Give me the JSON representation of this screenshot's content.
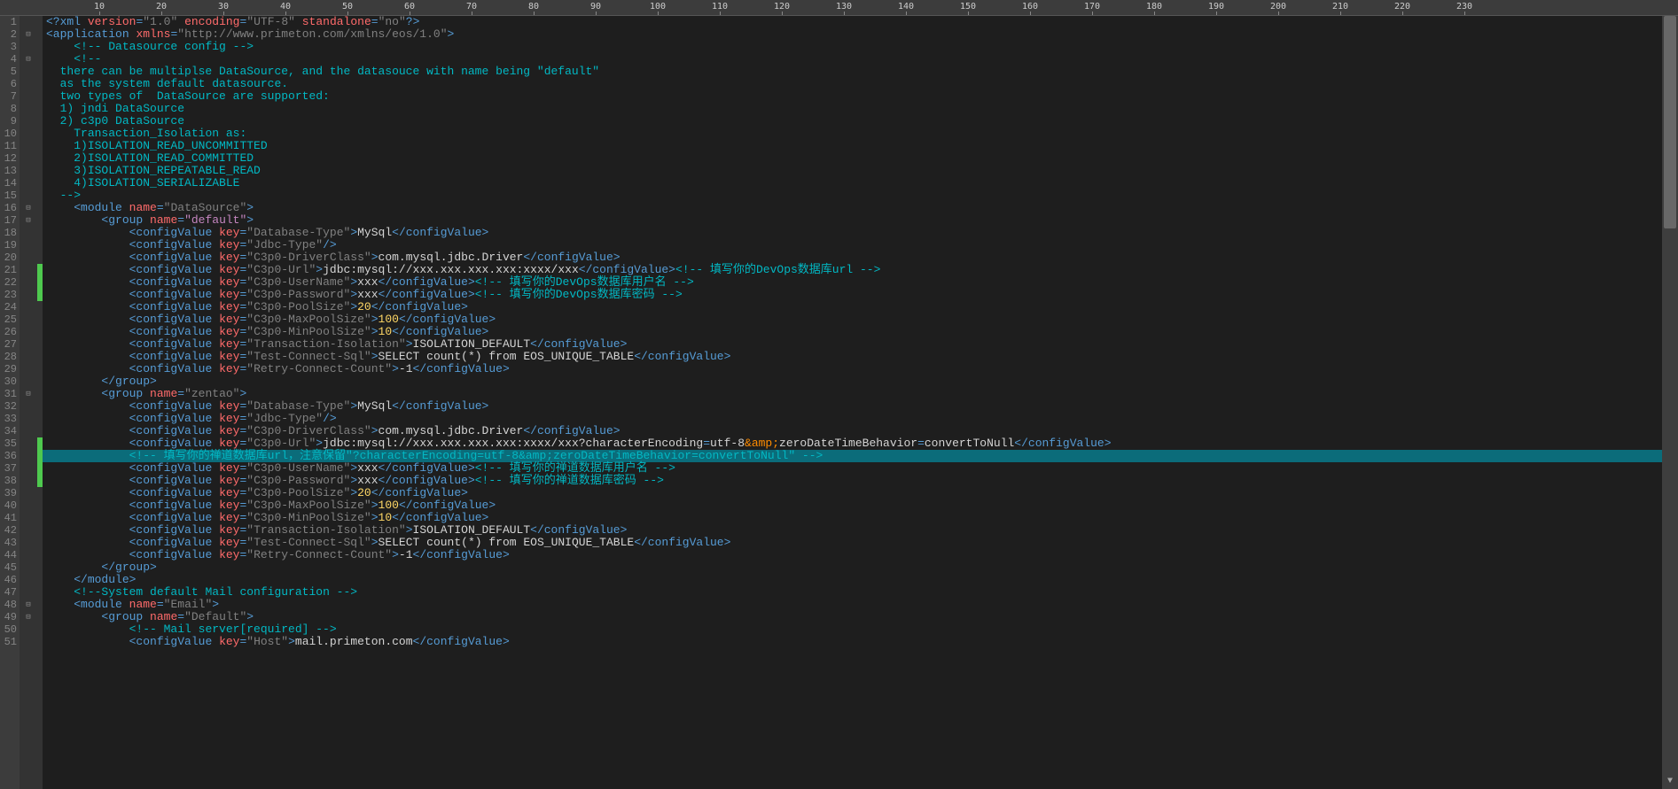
{
  "ruler": {
    "major_every": 10,
    "char_width": 7.0,
    "max": 230
  },
  "gutter": {
    "start": 1,
    "end": 51
  },
  "fold_markers": {
    "2": "-",
    "4": "-",
    "16": "-",
    "17": "-",
    "31": "-",
    "48": "-",
    "49": "-"
  },
  "change_markers": [
    21,
    22,
    23,
    35,
    36,
    37,
    38
  ],
  "highlighted_line": 36,
  "lines": [
    {
      "n": 1,
      "html": "<span class='tag'>&lt;?</span><span class='pi'>xml</span> <span class='att-n'>version</span><span class='tag'>=</span><span class='str'>\"1.0\"</span> <span class='att-n'>encoding</span><span class='tag'>=</span><span class='str'>\"UTF-8\"</span> <span class='att-n'>standalone</span><span class='tag'>=</span><span class='str'>\"no\"</span><span class='tag'>?&gt;</span>"
    },
    {
      "n": 2,
      "html": "<span class='tag'>&lt;application</span> <span class='att-n'>xmlns</span><span class='tag'>=</span><span class='str'>\"http://www.primeton.com/xmlns/eos/1.0\"</span><span class='tag'>&gt;</span>"
    },
    {
      "n": 3,
      "html": "    <span class='cmt'>&lt;!-- Datasource config --&gt;</span>"
    },
    {
      "n": 4,
      "html": "    <span class='cmt'>&lt;!--</span>"
    },
    {
      "n": 5,
      "html": "  <span class='cmt'>there can be multiplse DataSource, and the datasouce with name being \"default\"</span>"
    },
    {
      "n": 6,
      "html": "  <span class='cmt'>as the system default datasource.</span>"
    },
    {
      "n": 7,
      "html": "  <span class='cmt'>two types of  DataSource are supported:</span>"
    },
    {
      "n": 8,
      "html": "  <span class='cmt'>1) jndi DataSource</span>"
    },
    {
      "n": 9,
      "html": "  <span class='cmt'>2) c3p0 DataSource</span>"
    },
    {
      "n": 10,
      "html": "    <span class='cmt'>Transaction_Isolation as:</span>"
    },
    {
      "n": 11,
      "html": "    <span class='cmt'>1)ISOLATION_READ_UNCOMMITTED</span>"
    },
    {
      "n": 12,
      "html": "    <span class='cmt'>2)ISOLATION_READ_COMMITTED</span>"
    },
    {
      "n": 13,
      "html": "    <span class='cmt'>3)ISOLATION_REPEATABLE_READ</span>"
    },
    {
      "n": 14,
      "html": "    <span class='cmt'>4)ISOLATION_SERIALIZABLE</span>"
    },
    {
      "n": 15,
      "html": "  <span class='cmt'>--&gt;</span>"
    },
    {
      "n": 16,
      "html": "    <span class='tag'>&lt;module</span> <span class='att-n'>name</span><span class='tag'>=</span><span class='str'>\"DataSource\"</span><span class='tag'>&gt;</span>"
    },
    {
      "n": 17,
      "html": "        <span class='tag'>&lt;group</span> <span class='att-n'>name</span><span class='tag'>=</span><span class='kw'>\"default\"</span><span class='tag'>&gt;</span>"
    },
    {
      "n": 18,
      "html": "            <span class='tag'>&lt;configValue</span> <span class='att-n'>key</span><span class='tag'>=</span><span class='str'>\"Database-Type\"</span><span class='tag'>&gt;</span><span class='txt'>MySql</span><span class='tag'>&lt;/configValue&gt;</span>"
    },
    {
      "n": 19,
      "html": "            <span class='tag'>&lt;configValue</span> <span class='att-n'>key</span><span class='tag'>=</span><span class='str'>\"Jdbc-Type\"</span><span class='tag'>/&gt;</span>"
    },
    {
      "n": 20,
      "html": "            <span class='tag'>&lt;configValue</span> <span class='att-n'>key</span><span class='tag'>=</span><span class='str'>\"C3p0-DriverClass\"</span><span class='tag'>&gt;</span><span class='txt'>com.mysql.jdbc.Driver</span><span class='tag'>&lt;/configValue&gt;</span>"
    },
    {
      "n": 21,
      "html": "            <span class='tag'>&lt;configValue</span> <span class='att-n'>key</span><span class='tag'>=</span><span class='str'>\"C3p0-Url\"</span><span class='tag'>&gt;</span><span class='txt'>jdbc:mysql://xxx.xxx.xxx.xxx:xxxx/xxx</span><span class='tag'>&lt;/configValue&gt;</span><span class='cmt'>&lt;!-- 填写你的DevOps数据库url --&gt;</span>"
    },
    {
      "n": 22,
      "html": "            <span class='tag'>&lt;configValue</span> <span class='att-n'>key</span><span class='tag'>=</span><span class='str'>\"C3p0-UserName\"</span><span class='tag'>&gt;</span><span class='txt'>xxx</span><span class='tag'>&lt;/configValue&gt;</span><span class='cmt'>&lt;!-- 填写你的DevOps数据库用户名 --&gt;</span>"
    },
    {
      "n": 23,
      "html": "            <span class='tag'>&lt;configValue</span> <span class='att-n'>key</span><span class='tag'>=</span><span class='str'>\"C3p0-Password\"</span><span class='tag'>&gt;</span><span class='txt'>xxx</span><span class='tag'>&lt;/configValue&gt;</span><span class='cmt'>&lt;!-- 填写你的DevOps数据库密码 --&gt;</span>"
    },
    {
      "n": 24,
      "html": "            <span class='tag'>&lt;configValue</span> <span class='att-n'>key</span><span class='tag'>=</span><span class='str'>\"C3p0-PoolSize\"</span><span class='tag'>&gt;</span><span class='num-lit'>20</span><span class='tag'>&lt;/configValue&gt;</span>"
    },
    {
      "n": 25,
      "html": "            <span class='tag'>&lt;configValue</span> <span class='att-n'>key</span><span class='tag'>=</span><span class='str'>\"C3p0-MaxPoolSize\"</span><span class='tag'>&gt;</span><span class='num-lit'>100</span><span class='tag'>&lt;/configValue&gt;</span>"
    },
    {
      "n": 26,
      "html": "            <span class='tag'>&lt;configValue</span> <span class='att-n'>key</span><span class='tag'>=</span><span class='str'>\"C3p0-MinPoolSize\"</span><span class='tag'>&gt;</span><span class='num-lit'>10</span><span class='tag'>&lt;/configValue&gt;</span>"
    },
    {
      "n": 27,
      "html": "            <span class='tag'>&lt;configValue</span> <span class='att-n'>key</span><span class='tag'>=</span><span class='str'>\"Transaction-Isolation\"</span><span class='tag'>&gt;</span><span class='txt'>ISOLATION_DEFAULT</span><span class='tag'>&lt;/configValue&gt;</span>"
    },
    {
      "n": 28,
      "html": "            <span class='tag'>&lt;configValue</span> <span class='att-n'>key</span><span class='tag'>=</span><span class='str'>\"Test-Connect-Sql\"</span><span class='tag'>&gt;</span><span class='txt'>SELECT count(*) from EOS_UNIQUE_TABLE</span><span class='tag'>&lt;/configValue&gt;</span>"
    },
    {
      "n": 29,
      "html": "            <span class='tag'>&lt;configValue</span> <span class='att-n'>key</span><span class='tag'>=</span><span class='str'>\"Retry-Connect-Count\"</span><span class='tag'>&gt;</span><span class='txt'>-1</span><span class='tag'>&lt;/configValue&gt;</span>"
    },
    {
      "n": 30,
      "html": "        <span class='tag'>&lt;/group&gt;</span>"
    },
    {
      "n": 31,
      "html": "        <span class='tag'>&lt;group</span> <span class='att-n'>name</span><span class='tag'>=</span><span class='str'>\"zentao\"</span><span class='tag'>&gt;</span>"
    },
    {
      "n": 32,
      "html": "            <span class='tag'>&lt;configValue</span> <span class='att-n'>key</span><span class='tag'>=</span><span class='str'>\"Database-Type\"</span><span class='tag'>&gt;</span><span class='txt'>MySql</span><span class='tag'>&lt;/configValue&gt;</span>"
    },
    {
      "n": 33,
      "html": "            <span class='tag'>&lt;configValue</span> <span class='att-n'>key</span><span class='tag'>=</span><span class='str'>\"Jdbc-Type\"</span><span class='tag'>/&gt;</span>"
    },
    {
      "n": 34,
      "html": "            <span class='tag'>&lt;configValue</span> <span class='att-n'>key</span><span class='tag'>=</span><span class='str'>\"C3p0-DriverClass\"</span><span class='tag'>&gt;</span><span class='txt'>com.mysql.jdbc.Driver</span><span class='tag'>&lt;/configValue&gt;</span>"
    },
    {
      "n": 35,
      "html": "            <span class='tag'>&lt;configValue</span> <span class='att-n'>key</span><span class='tag'>=</span><span class='str'>\"C3p0-Url\"</span><span class='tag'>&gt;</span><span class='txt'>jdbc:mysql://xxx.xxx.xxx.xxx:xxxx/xxx?characterEncoding</span><span class='tag'>=</span><span class='txt'>utf-8</span><span class='ent'>&amp;amp;</span><span class='txt'>zeroDateTimeBehavior</span><span class='tag'>=</span><span class='txt'>convertToNull</span><span class='tag'>&lt;/configValue&gt;</span>"
    },
    {
      "n": 36,
      "html": "            <span class='cmt'>&lt;!-- 填写你的禅道数据库url，注意保留\"?characterEncoding=utf-8&amp;amp;zeroDateTimeBehavior=convertToNull\" --&gt;</span>"
    },
    {
      "n": 37,
      "html": "            <span class='tag'>&lt;configValue</span> <span class='att-n'>key</span><span class='tag'>=</span><span class='str'>\"C3p0-UserName\"</span><span class='tag'>&gt;</span><span class='txt'>xxx</span><span class='tag'>&lt;/configValue&gt;</span><span class='cmt'>&lt;!-- 填写你的禅道数据库用户名 --&gt;</span>"
    },
    {
      "n": 38,
      "html": "            <span class='tag'>&lt;configValue</span> <span class='att-n'>key</span><span class='tag'>=</span><span class='str'>\"C3p0-Password\"</span><span class='tag'>&gt;</span><span class='txt'>xxx</span><span class='tag'>&lt;/configValue&gt;</span><span class='cmt'>&lt;!-- 填写你的禅道数据库密码 --&gt;</span>"
    },
    {
      "n": 39,
      "html": "            <span class='tag'>&lt;configValue</span> <span class='att-n'>key</span><span class='tag'>=</span><span class='str'>\"C3p0-PoolSize\"</span><span class='tag'>&gt;</span><span class='num-lit'>20</span><span class='tag'>&lt;/configValue&gt;</span>"
    },
    {
      "n": 40,
      "html": "            <span class='tag'>&lt;configValue</span> <span class='att-n'>key</span><span class='tag'>=</span><span class='str'>\"C3p0-MaxPoolSize\"</span><span class='tag'>&gt;</span><span class='num-lit'>100</span><span class='tag'>&lt;/configValue&gt;</span>"
    },
    {
      "n": 41,
      "html": "            <span class='tag'>&lt;configValue</span> <span class='att-n'>key</span><span class='tag'>=</span><span class='str'>\"C3p0-MinPoolSize\"</span><span class='tag'>&gt;</span><span class='num-lit'>10</span><span class='tag'>&lt;/configValue&gt;</span>"
    },
    {
      "n": 42,
      "html": "            <span class='tag'>&lt;configValue</span> <span class='att-n'>key</span><span class='tag'>=</span><span class='str'>\"Transaction-Isolation\"</span><span class='tag'>&gt;</span><span class='txt'>ISOLATION_DEFAULT</span><span class='tag'>&lt;/configValue&gt;</span>"
    },
    {
      "n": 43,
      "html": "            <span class='tag'>&lt;configValue</span> <span class='att-n'>key</span><span class='tag'>=</span><span class='str'>\"Test-Connect-Sql\"</span><span class='tag'>&gt;</span><span class='txt'>SELECT count(*) from EOS_UNIQUE_TABLE</span><span class='tag'>&lt;/configValue&gt;</span>"
    },
    {
      "n": 44,
      "html": "            <span class='tag'>&lt;configValue</span> <span class='att-n'>key</span><span class='tag'>=</span><span class='str'>\"Retry-Connect-Count\"</span><span class='tag'>&gt;</span><span class='txt'>-1</span><span class='tag'>&lt;/configValue&gt;</span>"
    },
    {
      "n": 45,
      "html": "        <span class='tag'>&lt;/group&gt;</span>"
    },
    {
      "n": 46,
      "html": "    <span class='tag'>&lt;/module&gt;</span>"
    },
    {
      "n": 47,
      "html": "    <span class='cmt'>&lt;!--System default Mail configuration --&gt;</span>"
    },
    {
      "n": 48,
      "html": "    <span class='tag'>&lt;module</span> <span class='att-n'>name</span><span class='tag'>=</span><span class='str'>\"Email\"</span><span class='tag'>&gt;</span>"
    },
    {
      "n": 49,
      "html": "        <span class='tag'>&lt;group</span> <span class='att-n'>name</span><span class='tag'>=</span><span class='str'>\"Default\"</span><span class='tag'>&gt;</span>"
    },
    {
      "n": 50,
      "html": "            <span class='cmt'>&lt;!-- Mail server[required] --&gt;</span>"
    },
    {
      "n": 51,
      "html": "            <span class='tag'>&lt;configValue</span> <span class='att-n'>key</span><span class='tag'>=</span><span class='str'>\"Host\"</span><span class='tag'>&gt;</span><span class='txt'>mail.primeton.com</span><span class='tag'>&lt;/configValue&gt;</span>"
    }
  ]
}
